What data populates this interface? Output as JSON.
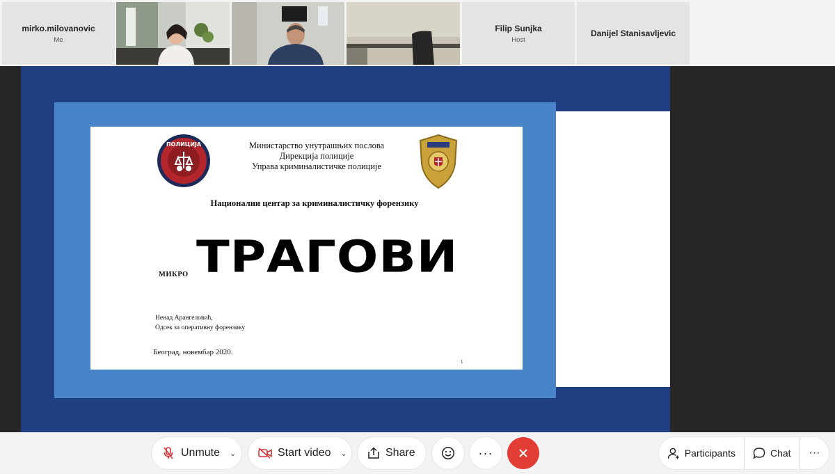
{
  "participants": [
    {
      "name": "mirko.milovanovic",
      "role": "Me"
    },
    {
      "name": "Filip Sunjka",
      "role": "Host"
    },
    {
      "name": "Danijel Stanisavljevic",
      "role": ""
    }
  ],
  "slide": {
    "ministry_lines": [
      "Министарство унутрашњих послова",
      "Дирекција полиције",
      "Управа криминалистичке полиције"
    ],
    "center_title": "Национални центар за криминалистичку форензику",
    "prefix": "МИКРО",
    "title": "ТРАГОВИ",
    "author_lines": [
      "Ненад Арангеловић,",
      "Одсек за оперативну форензику"
    ],
    "date": "Београд, новембар 2020.",
    "page_number": "1",
    "seal_text": "ПОЛИЦИЈА"
  },
  "toolbar": {
    "unmute_label": "Unmute",
    "start_video_label": "Start video",
    "share_label": "Share",
    "participants_label": "Participants",
    "chat_label": "Chat",
    "more_symbol": "···"
  },
  "colors": {
    "share_frame": "#203f83",
    "slide_border": "#4a84c8",
    "end_call": "#e23e36",
    "muted_mic": "#d13438"
  }
}
